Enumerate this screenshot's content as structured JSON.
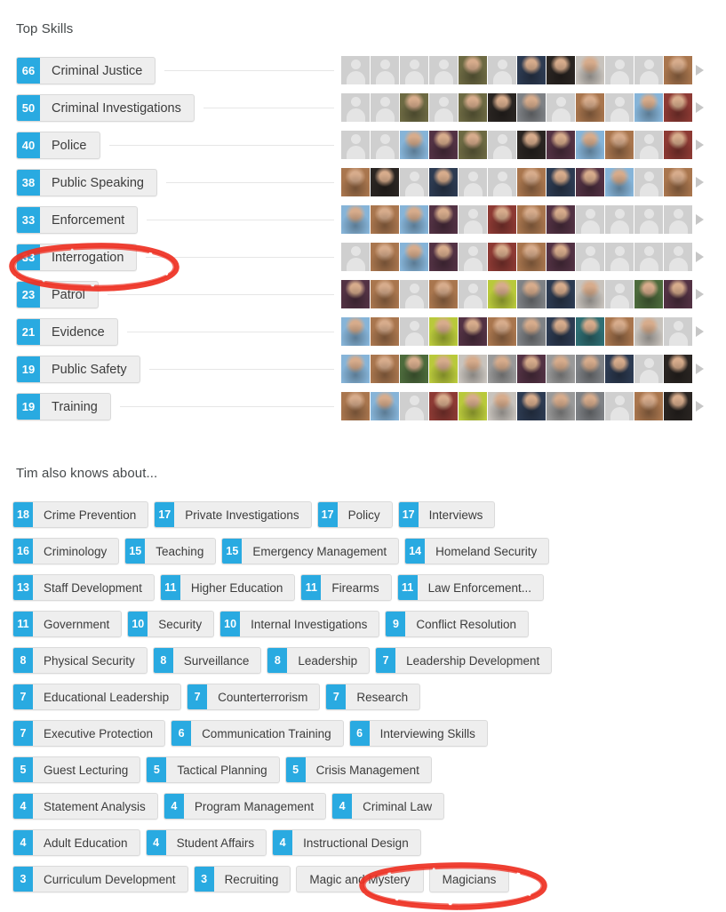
{
  "sections": {
    "top_skills_heading": "Top Skills",
    "also_knows_heading": "Tim also knows about..."
  },
  "top_skills": [
    {
      "count": "66",
      "name": "Criminal Justice"
    },
    {
      "count": "50",
      "name": "Criminal Investigations"
    },
    {
      "count": "40",
      "name": "Police"
    },
    {
      "count": "38",
      "name": "Public Speaking"
    },
    {
      "count": "33",
      "name": "Enforcement"
    },
    {
      "count": "33",
      "name": "Interrogation"
    },
    {
      "count": "23",
      "name": "Patrol"
    },
    {
      "count": "21",
      "name": "Evidence"
    },
    {
      "count": "19",
      "name": "Public Safety"
    },
    {
      "count": "19",
      "name": "Training"
    }
  ],
  "endorser_rows": [
    [
      "ph",
      "ph",
      "ph",
      "ph",
      "p-olive",
      "ph",
      "p-navy",
      "p-dark",
      "p-pale",
      "ph",
      "ph",
      "p-warm"
    ],
    [
      "ph",
      "ph",
      "p-olive",
      "ph",
      "p-olive",
      "p-dark",
      "p-gray",
      "ph",
      "p-warm",
      "ph",
      "p-sky",
      "p-red"
    ],
    [
      "ph",
      "ph",
      "p-sky",
      "p-plum",
      "p-olive",
      "ph",
      "p-dark",
      "p-plum",
      "p-sky",
      "p-warm",
      "ph",
      "p-red"
    ],
    [
      "p-warm",
      "p-dark",
      "ph",
      "p-navy",
      "ph",
      "ph",
      "p-warm",
      "p-navy",
      "p-plum",
      "p-sky",
      "ph",
      "p-warm"
    ],
    [
      "p-sky",
      "p-warm",
      "p-sky",
      "p-plum",
      "ph",
      "p-red",
      "p-warm",
      "p-plum",
      "ph",
      "ph",
      "ph",
      "ph"
    ],
    [
      "ph",
      "p-warm",
      "p-sky",
      "p-plum",
      "ph",
      "p-red",
      "p-warm",
      "p-plum",
      "ph",
      "ph",
      "ph",
      "ph"
    ],
    [
      "p-plum",
      "p-warm",
      "ph",
      "p-warm",
      "ph",
      "p-lime",
      "p-gray",
      "p-navy",
      "p-pale",
      "ph",
      "p-green",
      "p-plum"
    ],
    [
      "p-sky",
      "p-warm",
      "ph",
      "p-lime",
      "p-plum",
      "p-warm",
      "p-gray",
      "p-navy",
      "p-teal",
      "p-warm",
      "p-pale",
      "ph"
    ],
    [
      "p-sky",
      "p-warm",
      "p-green",
      "p-lime",
      "p-pale",
      "p-bw",
      "p-plum",
      "p-bw",
      "p-gray",
      "p-navy",
      "ph",
      "p-dark"
    ],
    [
      "p-warm",
      "p-sky",
      "ph",
      "p-red",
      "p-lime",
      "p-pale",
      "p-navy",
      "p-bw",
      "p-gray",
      "ph",
      "p-warm",
      "p-dark"
    ]
  ],
  "also_knows_rows": [
    [
      {
        "count": "18",
        "label": "Crime Prevention"
      },
      {
        "count": "17",
        "label": "Private Investigations"
      },
      {
        "count": "17",
        "label": "Policy"
      },
      {
        "count": "17",
        "label": "Interviews"
      }
    ],
    [
      {
        "count": "16",
        "label": "Criminology"
      },
      {
        "count": "15",
        "label": "Teaching"
      },
      {
        "count": "15",
        "label": "Emergency Management"
      },
      {
        "count": "14",
        "label": "Homeland Security"
      }
    ],
    [
      {
        "count": "13",
        "label": "Staff Development"
      },
      {
        "count": "11",
        "label": "Higher Education"
      },
      {
        "count": "11",
        "label": "Firearms"
      },
      {
        "count": "11",
        "label": "Law Enforcement..."
      }
    ],
    [
      {
        "count": "11",
        "label": "Government"
      },
      {
        "count": "10",
        "label": "Security"
      },
      {
        "count": "10",
        "label": "Internal Investigations"
      },
      {
        "count": "9",
        "label": "Conflict Resolution"
      }
    ],
    [
      {
        "count": "8",
        "label": "Physical Security"
      },
      {
        "count": "8",
        "label": "Surveillance"
      },
      {
        "count": "8",
        "label": "Leadership"
      },
      {
        "count": "7",
        "label": "Leadership Development"
      }
    ],
    [
      {
        "count": "7",
        "label": "Educational Leadership"
      },
      {
        "count": "7",
        "label": "Counterterrorism"
      },
      {
        "count": "7",
        "label": "Research"
      }
    ],
    [
      {
        "count": "7",
        "label": "Executive Protection"
      },
      {
        "count": "6",
        "label": "Communication Training"
      },
      {
        "count": "6",
        "label": "Interviewing Skills"
      }
    ],
    [
      {
        "count": "5",
        "label": "Guest Lecturing"
      },
      {
        "count": "5",
        "label": "Tactical Planning"
      },
      {
        "count": "5",
        "label": "Crisis Management"
      }
    ],
    [
      {
        "count": "4",
        "label": "Statement Analysis"
      },
      {
        "count": "4",
        "label": "Program Management"
      },
      {
        "count": "4",
        "label": "Criminal Law"
      }
    ],
    [
      {
        "count": "4",
        "label": "Adult Education"
      },
      {
        "count": "4",
        "label": "Student Affairs"
      },
      {
        "count": "4",
        "label": "Instructional Design"
      }
    ],
    [
      {
        "count": "3",
        "label": "Curriculum Development"
      },
      {
        "count": "3",
        "label": "Recruiting"
      },
      {
        "count": "",
        "label": "Magic and Mystery"
      },
      {
        "count": "",
        "label": "Magicians"
      }
    ]
  ],
  "annotations": [
    {
      "target": "Interrogation",
      "shape": "ellipse",
      "color": "#ee3124"
    },
    {
      "target": "Magic and Mystery",
      "shape": "ellipse",
      "color": "#ee3124"
    }
  ],
  "colors": {
    "accent_blue": "#29aae1",
    "chip_gray": "#eeeeee",
    "annotation_red": "#ee3124"
  }
}
